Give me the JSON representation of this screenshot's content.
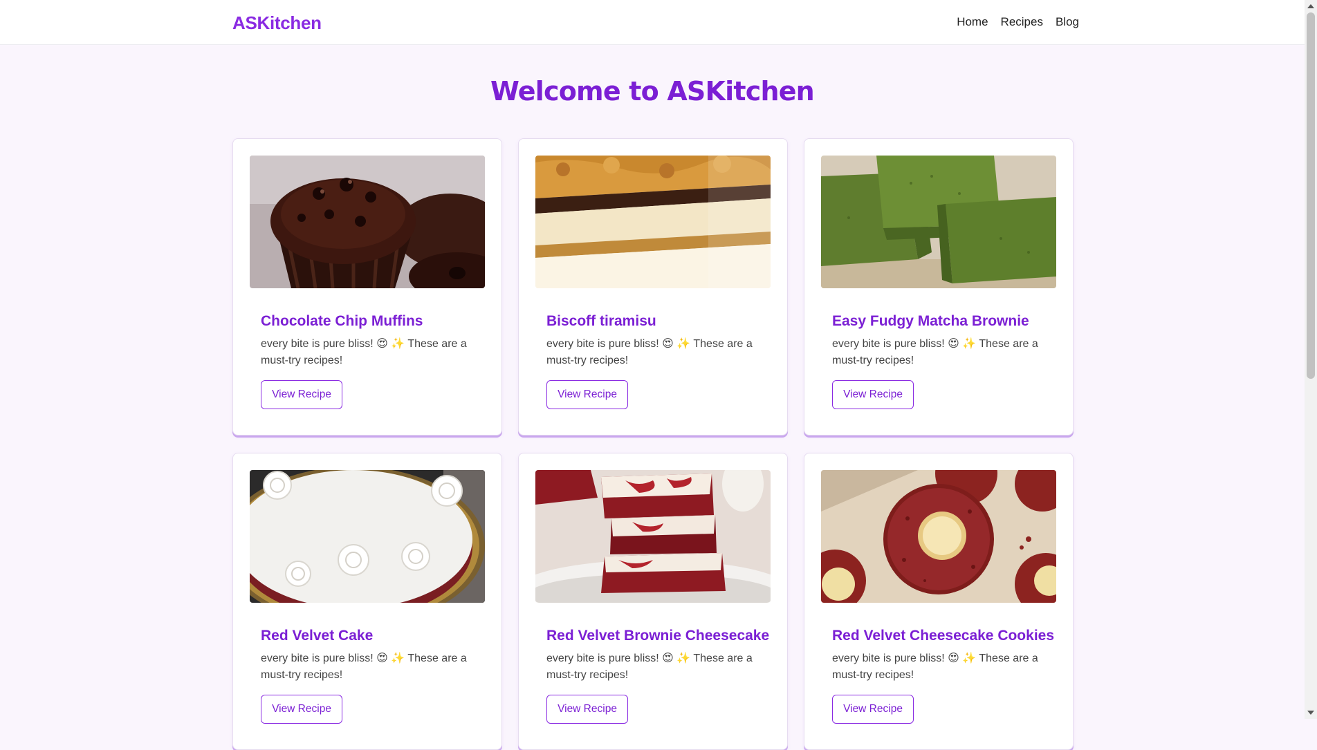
{
  "brand": "ASKitchen",
  "nav": {
    "items": [
      "Home",
      "Recipes",
      "Blog"
    ]
  },
  "hero": {
    "title": "Welcome to ASKitchen"
  },
  "cards": [
    {
      "title": "Chocolate Chip Muffins",
      "text": "every bite is pure bliss! 😍 ✨ These are a must-try recipes!",
      "button": "View Recipe"
    },
    {
      "title": "Biscoff tiramisu",
      "text": "every bite is pure bliss! 😍 ✨ These are a must-try recipes!",
      "button": "View Recipe"
    },
    {
      "title": "Easy Fudgy Matcha Brownie",
      "text": "every bite is pure bliss! 😍 ✨ These are a must-try recipes!",
      "button": "View Recipe"
    },
    {
      "title": "Red Velvet Cake",
      "text": "every bite is pure bliss! 😍 ✨ These are a must-try recipes!",
      "button": "View Recipe"
    },
    {
      "title": "Red Velvet Brownie Cheesecake",
      "text": "every bite is pure bliss! 😍 ✨ These are a must-try recipes!",
      "button": "View Recipe"
    },
    {
      "title": "Red Velvet Cheesecake Cookies",
      "text": "every bite is pure bliss! 😍 ✨ These are a must-try recipes!",
      "button": "View Recipe"
    }
  ],
  "colors": {
    "accent": "#8a2be2",
    "heading": "#7b1fd4",
    "background": "#faf5fd"
  }
}
